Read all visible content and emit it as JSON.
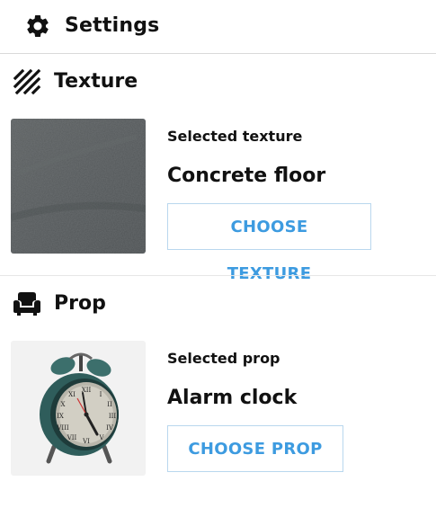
{
  "header": {
    "icon": "gear-icon",
    "title": "Settings"
  },
  "texture_section": {
    "icon": "diagonal-stripes-icon",
    "title": "Texture",
    "caption": "Selected texture",
    "value": "Concrete floor",
    "button_label": "CHOOSE TEXTURE",
    "thumbnail_color": "#565a5b"
  },
  "prop_section": {
    "icon": "armchair-icon",
    "title": "Prop",
    "caption": "Selected prop",
    "value": "Alarm clock",
    "button_label": "CHOOSE PROP",
    "thumbnail_color": "#f2f2f2"
  },
  "colors": {
    "accent": "#3d9be0",
    "button_border": "#b9d7ee",
    "divider": "#d9d9d9"
  }
}
